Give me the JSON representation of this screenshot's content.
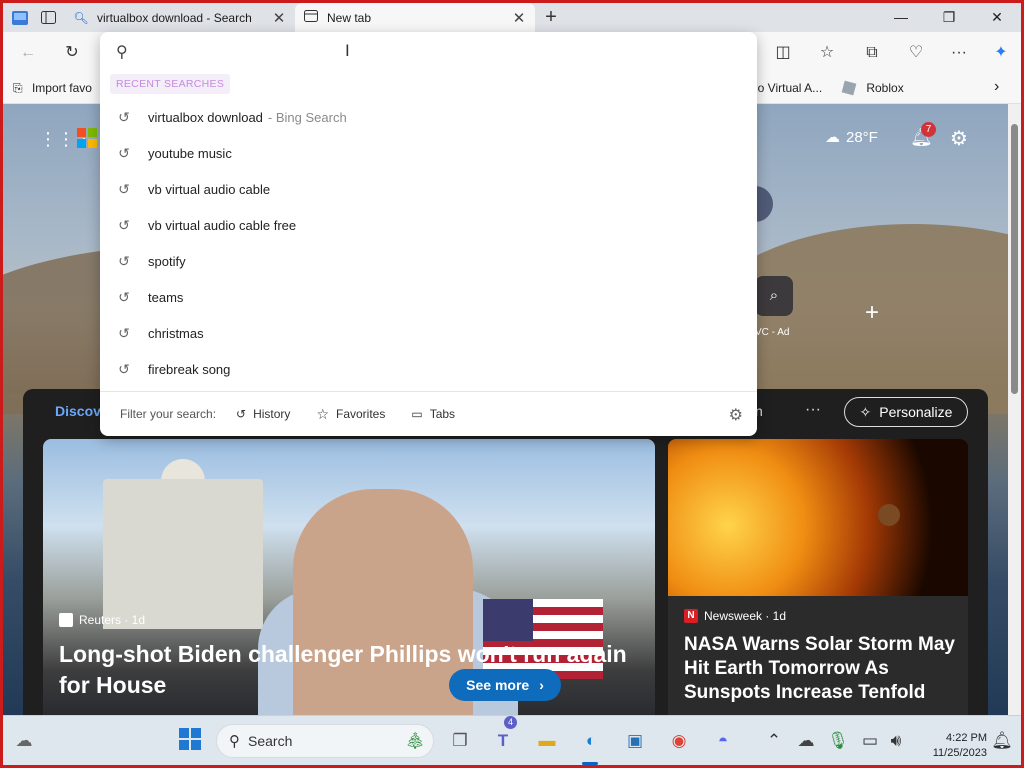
{
  "browser": {
    "tabs": [
      {
        "title": "virtualbox download - Search",
        "icon": "search-icon",
        "active": false
      },
      {
        "title": "New tab",
        "icon": "newtab-icon",
        "active": true
      }
    ],
    "new_tab_glyph": "+",
    "window_controls": {
      "minimize": "—",
      "maximize": "❐",
      "close": "✕"
    }
  },
  "toolbar": {
    "back": "←",
    "refresh": "↻",
    "split": "◫",
    "favorites": "☆",
    "collections": "⧉",
    "performance": "♡",
    "more": "···",
    "copilot": "✦"
  },
  "favorites_bar": {
    "import": "Import favo",
    "item2": "io Virtual A...",
    "roblox": "Roblox",
    "more": "›"
  },
  "dropdown": {
    "search_value": "",
    "recent_heading": "RECENT SEARCHES",
    "items": [
      {
        "text": "virtualbox download",
        "suffix": "- Bing Search"
      },
      {
        "text": "youtube music",
        "suffix": ""
      },
      {
        "text": "vb virtual audio cable",
        "suffix": ""
      },
      {
        "text": "vb virtual audio cable free",
        "suffix": ""
      },
      {
        "text": "spotify",
        "suffix": ""
      },
      {
        "text": "teams",
        "suffix": ""
      },
      {
        "text": "christmas",
        "suffix": ""
      },
      {
        "text": "firebreak song",
        "suffix": ""
      }
    ],
    "filter_label": "Filter your search:",
    "filter_history": "History",
    "filter_favorites": "Favorites",
    "filter_tabs": "Tabs"
  },
  "newtab": {
    "weather_temp": "28°F",
    "notifications_count": "7",
    "quicklink_label": "VC - Ad",
    "add_glyph": "+"
  },
  "feed": {
    "discover": "Discov",
    "n_fragment": "n",
    "more": "···",
    "personalize": "Personalize",
    "card1": {
      "source": "Reuters · 1d",
      "title": "Long-shot Biden challenger Phillips won't run again for House",
      "see_more": "See more"
    },
    "card2": {
      "source": "Newsweek · 1d",
      "title": "NASA Warns Solar Storm May Hit Earth Tomorrow As Sunspots Increase Tenfold"
    }
  },
  "taskbar": {
    "search_text": "Search",
    "teams_badge": "4",
    "time": "4:22 PM",
    "date": "11/25/2023"
  },
  "colors": {
    "accent": "#0f6cbd",
    "badge": "#d13438",
    "recent_heading": "#c68ae0",
    "frame": "#cc1b1b"
  }
}
